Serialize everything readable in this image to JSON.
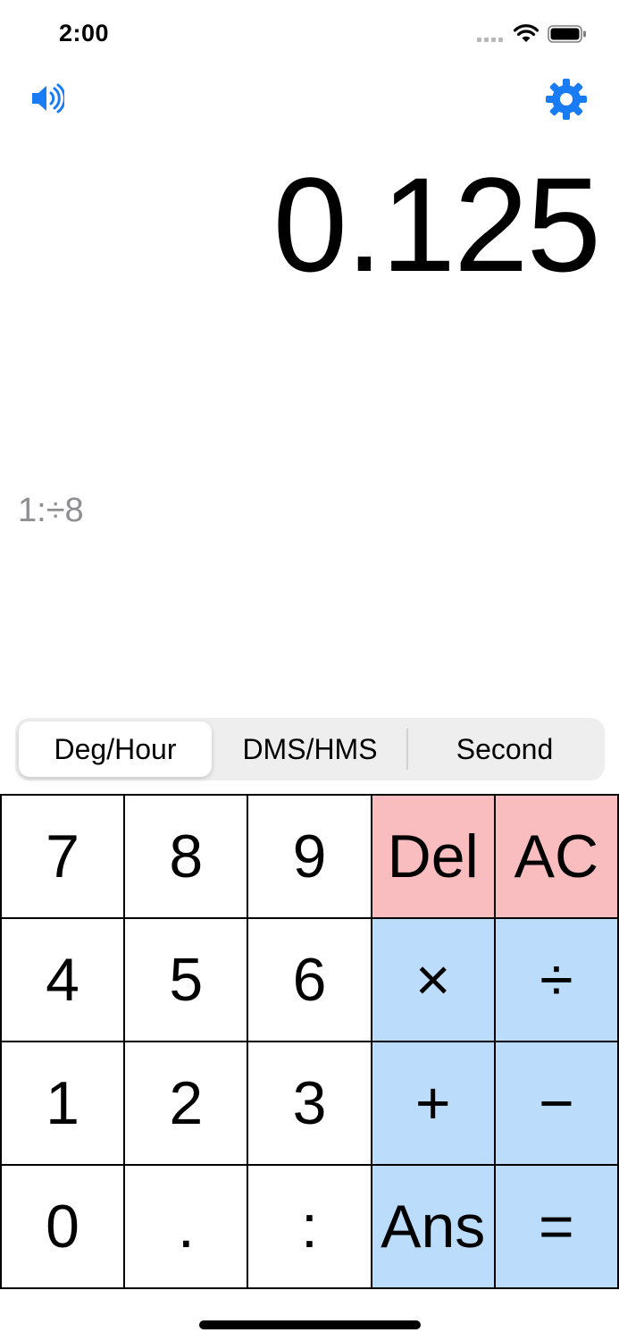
{
  "status_bar": {
    "time": "2:00"
  },
  "toolbar": {
    "speaker_icon": "speaker-volume-icon",
    "settings_icon": "gear-icon",
    "accent_color": "#1a7cf5"
  },
  "display": {
    "value": "0.125",
    "history": "1:÷8"
  },
  "modes": {
    "selected": "Deg/Hour",
    "items": [
      "Deg/Hour",
      "DMS/HMS",
      "Second"
    ]
  },
  "keypad": {
    "rows": [
      [
        "7",
        "8",
        "9",
        "Del",
        "AC"
      ],
      [
        "4",
        "5",
        "6",
        "×",
        "÷"
      ],
      [
        "1",
        "2",
        "3",
        "+",
        "−"
      ],
      [
        "0",
        ".",
        ":",
        "Ans",
        "="
      ]
    ],
    "colors": {
      "clear_keys": "#f9bcbf",
      "operator_keys": "#bcdcfb",
      "digit_keys": "#ffffff"
    }
  }
}
